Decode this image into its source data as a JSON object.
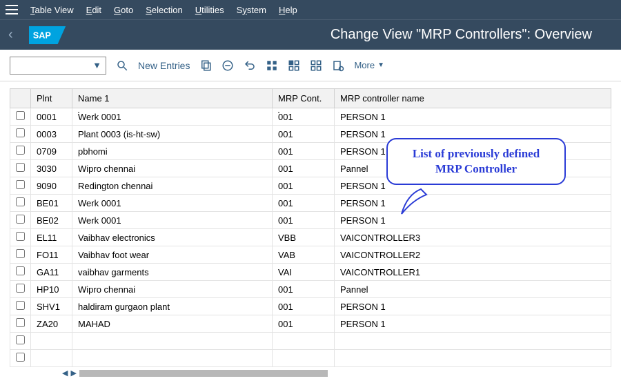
{
  "menu": {
    "items": [
      "Table View",
      "Edit",
      "Goto",
      "Selection",
      "Utilities",
      "System",
      "Help"
    ]
  },
  "header": {
    "title": "Change View \"MRP Controllers\": Overview"
  },
  "toolbar": {
    "new_entries": "New Entries",
    "more": "More"
  },
  "columns": {
    "plnt": "Plnt",
    "name": "Name 1",
    "mrp": "MRP Cont.",
    "ctrlname": "MRP controller name"
  },
  "rows": [
    {
      "plnt": "0001",
      "name": "Werk 0001",
      "mrp": "001",
      "ctrl": "PERSON 1"
    },
    {
      "plnt": "0003",
      "name": "Plant 0003 (is-ht-sw)",
      "mrp": "001",
      "ctrl": "PERSON 1"
    },
    {
      "plnt": "0709",
      "name": "pbhomi",
      "mrp": "001",
      "ctrl": "PERSON 1"
    },
    {
      "plnt": "3030",
      "name": "Wipro chennai",
      "mrp": "001",
      "ctrl": "Pannel"
    },
    {
      "plnt": "9090",
      "name": "Redington chennai",
      "mrp": "001",
      "ctrl": "PERSON 1"
    },
    {
      "plnt": "BE01",
      "name": "Werk 0001",
      "mrp": "001",
      "ctrl": "PERSON 1"
    },
    {
      "plnt": "BE02",
      "name": "Werk 0001",
      "mrp": "001",
      "ctrl": "PERSON 1"
    },
    {
      "plnt": "EL11",
      "name": "Vaibhav electronics",
      "mrp": "VBB",
      "ctrl": "VAICONTROLLER3"
    },
    {
      "plnt": "FO11",
      "name": "Vaibhav foot wear",
      "mrp": "VAB",
      "ctrl": "VAICONTROLLER2"
    },
    {
      "plnt": "GA11",
      "name": "vaibhav garments",
      "mrp": "VAI",
      "ctrl": "VAICONTROLLER1"
    },
    {
      "plnt": "HP10",
      "name": "Wipro chennai",
      "mrp": "001",
      "ctrl": "Pannel"
    },
    {
      "plnt": "SHV1",
      "name": "haldiram gurgaon plant",
      "mrp": "001",
      "ctrl": "PERSON 1"
    },
    {
      "plnt": "ZA20",
      "name": "MAHAD",
      "mrp": "001",
      "ctrl": "PERSON 1"
    }
  ],
  "callout": {
    "line1": "List of previously defined",
    "line2": "MRP Controller"
  }
}
